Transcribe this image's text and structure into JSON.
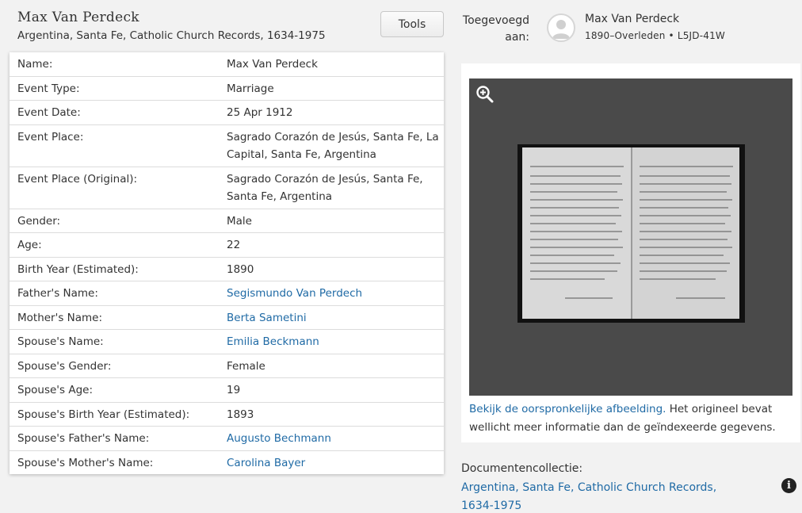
{
  "header": {
    "title": "Max Van Perdeck",
    "subtitle": "Argentina, Santa Fe, Catholic Church Records, 1634-1975",
    "tools_label": "Tools"
  },
  "record": {
    "rows": [
      {
        "label": "Name:",
        "value": "Max Van Perdeck",
        "link": false
      },
      {
        "label": "Event Type:",
        "value": "Marriage",
        "link": false
      },
      {
        "label": "Event Date:",
        "value": "25 Apr 1912",
        "link": false
      },
      {
        "label": "Event Place:",
        "value": "Sagrado Corazón de Jesús, Santa Fe, La Capital, Santa Fe, Argentina",
        "link": false
      },
      {
        "label": "Event Place (Original):",
        "value": "Sagrado Corazón de Jesús, Santa Fe, Santa Fe, Argentina",
        "link": false
      },
      {
        "label": "Gender:",
        "value": "Male",
        "link": false
      },
      {
        "label": "Age:",
        "value": "22",
        "link": false
      },
      {
        "label": "Birth Year (Estimated):",
        "value": "1890",
        "link": false
      },
      {
        "label": "Father's Name:",
        "value": "Segismundo Van Perdech",
        "link": true
      },
      {
        "label": "Mother's Name:",
        "value": "Berta Sametini",
        "link": true
      },
      {
        "label": "Spouse's Name:",
        "value": "Emilia Beckmann",
        "link": true
      },
      {
        "label": "Spouse's Gender:",
        "value": "Female",
        "link": false
      },
      {
        "label": "Spouse's Age:",
        "value": "19",
        "link": false
      },
      {
        "label": "Spouse's Birth Year (Estimated):",
        "value": "1893",
        "link": false
      },
      {
        "label": "Spouse's Father's Name:",
        "value": "Augusto Bechmann",
        "link": true
      },
      {
        "label": "Spouse's Mother's Name:",
        "value": "Carolina Bayer",
        "link": true
      }
    ]
  },
  "attached": {
    "label": "Toegevoegd aan:",
    "person_name": "Max Van Perdeck",
    "person_meta": "1890–Overleden • L5JD-41W"
  },
  "image_panel": {
    "zoom_icon": "zoom-in-icon",
    "caption_link": "Bekijk de oorspronkelijke afbeelding.",
    "caption_text": " Het origineel bevat wellicht meer informatie dan de geïndexeerde gegevens."
  },
  "collection": {
    "label": "Documentencollectie:",
    "link": "Argentina, Santa Fe, Catholic Church Records, 1634-1975",
    "info_icon": "info-icon"
  },
  "colors": {
    "link": "#1f6aa5",
    "background": "#f2f2f2",
    "viewer_bg": "#4a4a4a"
  }
}
